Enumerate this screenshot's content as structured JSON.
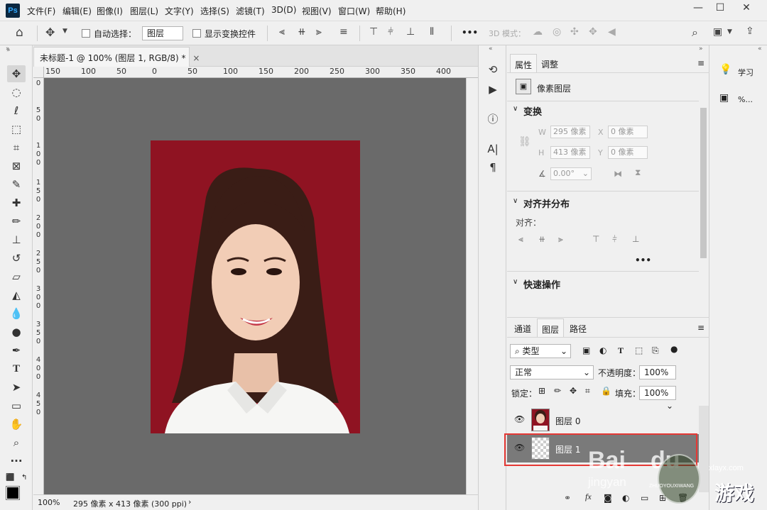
{
  "app": {
    "logo": "Ps"
  },
  "menu": [
    "文件(F)",
    "编辑(E)",
    "图像(I)",
    "图层(L)",
    "文字(Y)",
    "选择(S)",
    "滤镜(T)",
    "3D(D)",
    "视图(V)",
    "窗口(W)",
    "帮助(H)"
  ],
  "window_controls": {
    "minimize": "—",
    "maximize": "☐",
    "close": "✕"
  },
  "options": {
    "auto_select_label": "自动选择：",
    "auto_select_value": "图层",
    "show_transform_label": "显示变换控件",
    "more": "•••",
    "mode_3d_label": "3D 模式："
  },
  "document": {
    "tab_title": "未标题-1 @ 100% (图层 1, RGB/8) *",
    "tab_close": "×",
    "ruler_top": [
      "150",
      "100",
      "50",
      "0",
      "50",
      "100",
      "150",
      "200",
      "250",
      "300",
      "350",
      "400"
    ],
    "ruler_left": [
      "0",
      "5",
      "0",
      "1",
      "0",
      "0",
      "1",
      "5",
      "0",
      "2",
      "0",
      "0",
      "2",
      "5",
      "0",
      "3",
      "0",
      "0",
      "3",
      "5",
      "0",
      "4",
      "0",
      "0",
      "4",
      "5",
      "0"
    ],
    "zoom": "100%",
    "size_info": "295 像素 x 413 像素 (300 ppi)",
    "status_arrow": "›"
  },
  "properties": {
    "tabs": [
      "属性",
      "调整"
    ],
    "layer_type": "像素图层",
    "transform_title": "变换",
    "w_label": "W",
    "w_value": "295 像素",
    "x_label": "X",
    "x_value": "0 像素",
    "h_label": "H",
    "h_value": "413 像素",
    "y_label": "Y",
    "y_value": "0 像素",
    "angle_value": "0.00°",
    "align_title": "对齐并分布",
    "align_label": "对齐：",
    "align_more": "•••",
    "quick_title": "快速操作"
  },
  "layers": {
    "tabs": [
      "通道",
      "图层",
      "路径"
    ],
    "filter_kind": "类型",
    "blend_mode": "正常",
    "opacity_label": "不透明度：",
    "opacity_value": "100%",
    "lock_label": "锁定：",
    "fill_label": "填充：",
    "fill_value": "100%",
    "items": [
      {
        "name": "图层 0"
      },
      {
        "name": "图层 1"
      }
    ],
    "footer_fx": "fx"
  },
  "rail": {
    "learn": "学习",
    "percent": "%..."
  },
  "watermark": {
    "baidu": "Bai",
    "du": "du",
    "jingyan": "jingyan",
    "site": "xlayx.com",
    "game": "游戏",
    "sub": "ZHUOYOUXIWANG"
  },
  "colors": {
    "accent_red_box": "#e53935",
    "photo_bg": "#8f1322",
    "canvas_bg": "#6a6a6a"
  }
}
